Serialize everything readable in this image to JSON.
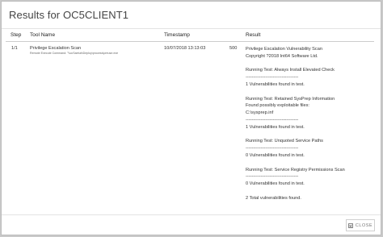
{
  "dialog": {
    "title": "Results for OC5CLIENT1"
  },
  "table": {
    "headers": {
      "step": "Step",
      "tool_name": "Tool Name",
      "timestamp": "Timestamp",
      "result": "Result"
    },
    "row": {
      "step": "1/1",
      "tool_name": "Privilege Escalation Scan",
      "tool_sub": "Remote Execute Command: \"\\\\ocSaetub\\Deploy\\process\\preuse.exe",
      "timestamp": "10/07/2018 13:13:03",
      "code": "500",
      "result_lines": [
        "Privilege Escalation Vulnerability Scan",
        "Copyright ?2018 Int64 Software Ltd.",
        "",
        "Running Test: Always Install Elevated Check",
        "-----------------------------------",
        "1 Vulnerabilities found in test.",
        "",
        "Running Test: Retained SysPrep Information",
        "Found possibly exploitable files:",
        "C:\\sysprep.inf",
        "-----------------------------------",
        "1 Vulnerabilities found in test.",
        "",
        "Running Test: Unquoted Service Paths",
        "-----------------------------------",
        "0 Vulnerabilities found in test.",
        "",
        "Running Test: Service Registry Permissions Scan",
        "-----------------------------------",
        "0 Vulnerabilities found in test.",
        "",
        "2 Total vulnerabilities found."
      ]
    }
  },
  "footer": {
    "close_label": "CLOSE",
    "close_icon": "close-icon"
  }
}
